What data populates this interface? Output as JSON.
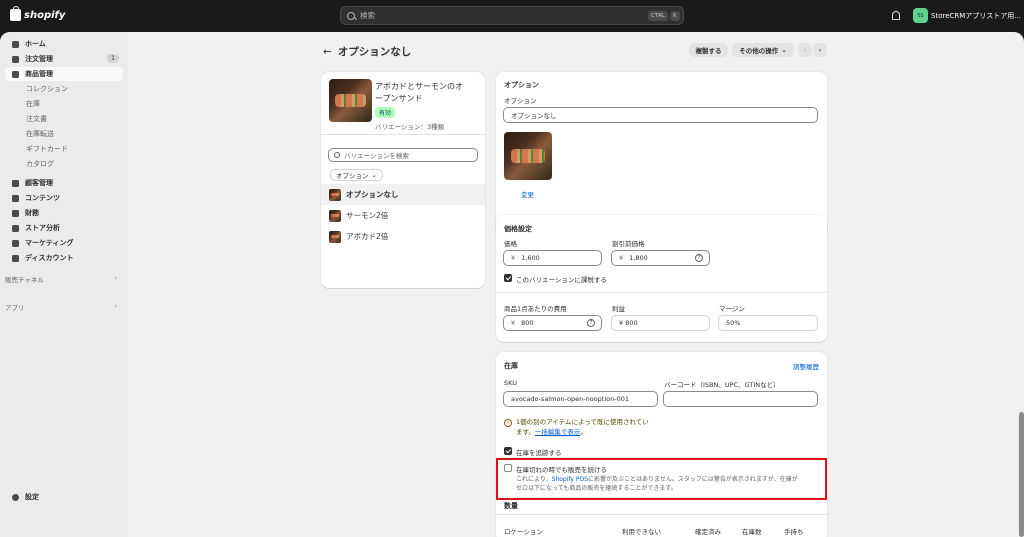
{
  "topbar": {
    "logo": "shopify",
    "search_placeholder": "検索",
    "shortcut_ctrl": "CTRL",
    "shortcut_k": "K",
    "store_name": "StoreCRMアプリストア用...",
    "store_initials": "SS"
  },
  "sidebar": {
    "items": [
      {
        "label": "ホーム",
        "icon": "home-icon"
      },
      {
        "label": "注文管理",
        "icon": "inbox-icon",
        "badge": "1"
      },
      {
        "label": "商品管理",
        "icon": "tag-icon"
      },
      {
        "label": "コレクション"
      },
      {
        "label": "在庫"
      },
      {
        "label": "注文書"
      },
      {
        "label": "在庫転送"
      },
      {
        "label": "ギフトカード"
      },
      {
        "label": "カタログ"
      },
      {
        "label": "顧客管理",
        "icon": "person-icon"
      },
      {
        "label": "コンテンツ",
        "icon": "content-icon"
      },
      {
        "label": "財務",
        "icon": "bank-icon"
      },
      {
        "label": "ストア分析",
        "icon": "chart-icon"
      },
      {
        "label": "マーケティング",
        "icon": "target-icon"
      },
      {
        "label": "ディスカウント",
        "icon": "discount-icon"
      }
    ],
    "sales_channels": "販売チャネル",
    "apps": "アプリ",
    "settings": "設定"
  },
  "header": {
    "back_arrow": "←",
    "title": "オプションなし",
    "duplicate": "複製する",
    "more_actions": "その他の操作",
    "prev": "‹",
    "next": "›"
  },
  "product_card": {
    "name_line1": "アボカドとサーモンのオ",
    "name_line2": "ープンサンド",
    "status": "有効",
    "variant_count": "バリエーション：3種類",
    "search_placeholder": "バリエーションを検索",
    "filter_label": "オプション",
    "variants": [
      "オプションなし",
      "サーモン2倍",
      "アボカド2倍"
    ]
  },
  "option_card": {
    "heading": "オプション",
    "field_label": "オプション",
    "field_value": "オプションなし",
    "change_link": "変更"
  },
  "pricing": {
    "heading": "価格設定",
    "price_label": "価格",
    "price_value": "1,600",
    "compare_label": "割引前価格",
    "compare_value": "1,800",
    "currency": "¥",
    "tax_label": "このバリエーションに課税する",
    "cost_label": "商品1点あたりの費用",
    "cost_value": "800",
    "profit_label": "利益",
    "profit_value": "¥ 800",
    "margin_label": "マージン",
    "margin_value": "50%"
  },
  "inventory": {
    "heading": "在庫",
    "history_link": "調整履歴",
    "sku_label": "SKU",
    "sku_value": "avocado-salmon-open-nooption-001",
    "barcode_label": "バーコード（ISBN、UPC、GTINなど）",
    "warning_line1": "1個の別のアイテムによって既に使用されてい",
    "warning_line2": "ます。",
    "warning_link": "一括編集で表示",
    "warning_end": "。",
    "track_label": "在庫を追跡する",
    "continue_label": "在庫切れの時でも販売を続ける",
    "continue_desc1_a": "これにより、",
    "continue_desc1_link": "Shopify POS",
    "continue_desc1_b": "に影響が及ぶことはありません。スタッフには警告が表示されますが、在庫が",
    "continue_desc2": "ゼロ以下になっても商品の販売を継続することができます。",
    "quantity_heading": "数量",
    "columns": [
      "ロケーション",
      "利用できない",
      "確定済み",
      "在庫数",
      "手持ち"
    ]
  }
}
